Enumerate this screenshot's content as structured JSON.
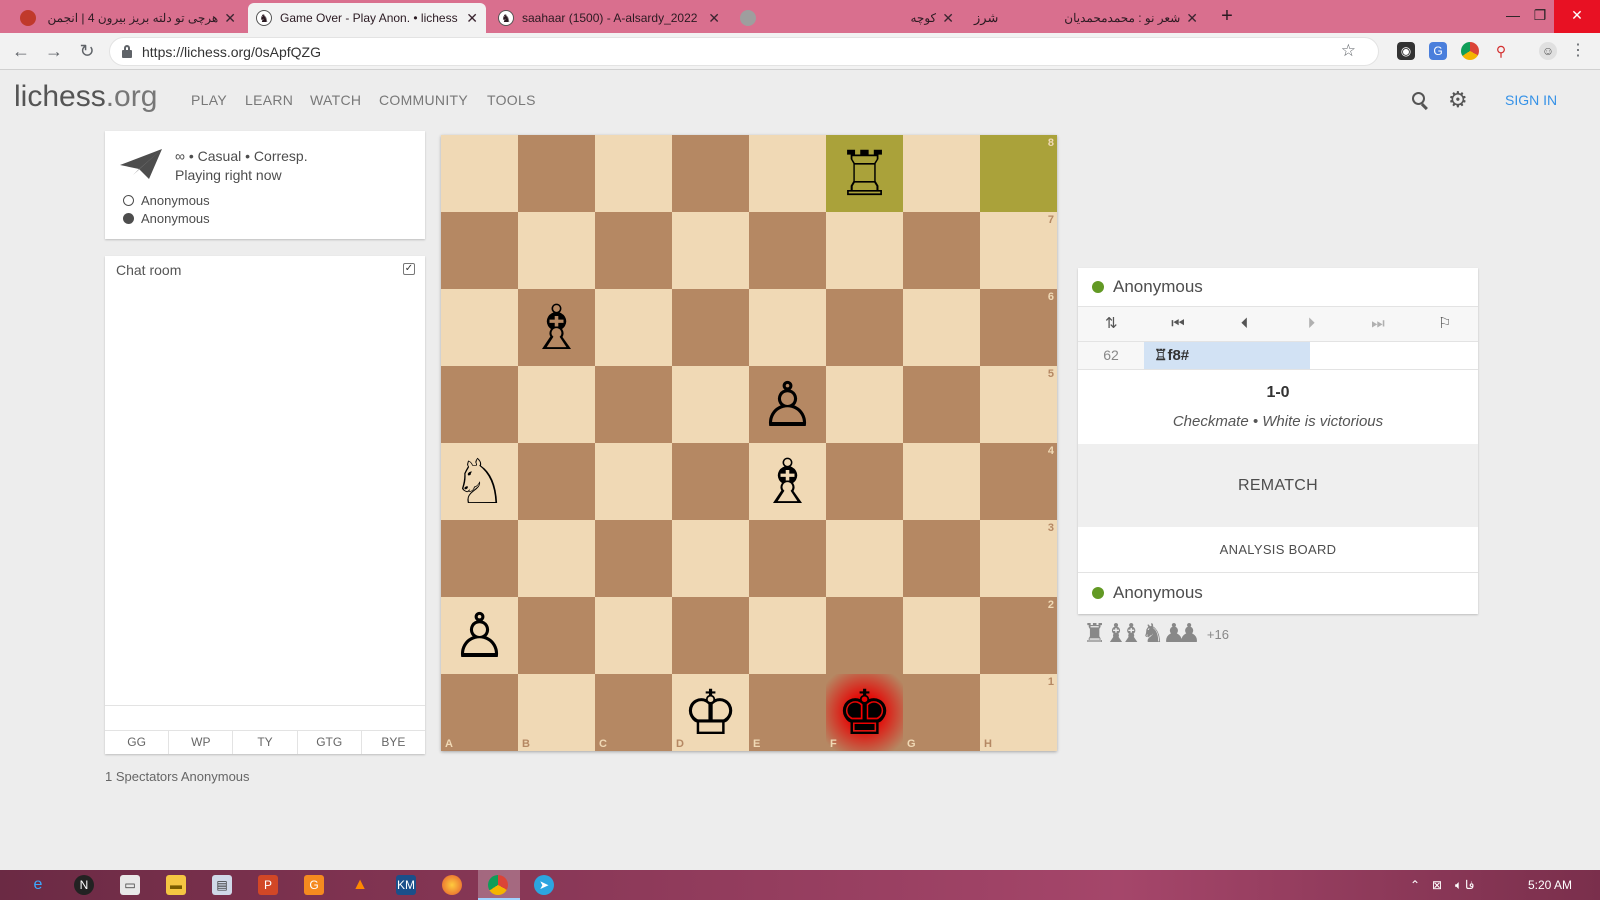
{
  "browser": {
    "tabs": [
      {
        "title": "هرچی تو دلته بریز بیرون 4 | انجمن",
        "rtl": true,
        "favicon_color": "#c0392b"
      },
      {
        "title": "Game Over - Play Anon. • lichess",
        "rtl": false,
        "favicon_color": "#ffffff"
      },
      {
        "title": "saahaar (1500) - A-alsardy_2022",
        "rtl": false,
        "favicon_color": "#ffffff"
      },
      {
        "title": "کوچه",
        "rtl": true,
        "favicon_color": "#9e9e9e"
      },
      {
        "title": "شعر نو : محمدمحمدیان",
        "rtl": true,
        "favicon_color": "#d96f8e"
      }
    ],
    "url": "https://lichess.org/0sApfQZG",
    "window_controls": {
      "minimize": "—",
      "restore": "❐",
      "close": "✕"
    }
  },
  "site": {
    "logo_main": "lichess",
    "logo_tld": ".org",
    "nav": [
      "PLAY",
      "LEARN",
      "WATCH",
      "COMMUNITY",
      "TOOLS"
    ],
    "sign_in": "SIGN IN"
  },
  "game_info": {
    "setup": "∞ • Casual • Corresp.",
    "status": "Playing right now",
    "players": [
      {
        "name": "Anonymous",
        "color": "white"
      },
      {
        "name": "Anonymous",
        "color": "black"
      }
    ]
  },
  "chat": {
    "title": "Chat room",
    "enabled": true,
    "presets": [
      "GG",
      "WP",
      "TY",
      "GTG",
      "BYE"
    ]
  },
  "spectators": "1 Spectators Anonymous",
  "board": {
    "files": [
      "A",
      "B",
      "C",
      "D",
      "E",
      "F",
      "G",
      "H"
    ],
    "ranks": [
      "8",
      "7",
      "6",
      "5",
      "4",
      "3",
      "2",
      "1"
    ],
    "last_move_squares": [
      "f8",
      "h8"
    ],
    "check_square": "f1",
    "pieces": [
      {
        "square": "f8",
        "glyph": "♖",
        "name": "white-rook"
      },
      {
        "square": "b6",
        "glyph": "♗",
        "name": "white-bishop"
      },
      {
        "square": "e5",
        "glyph": "♙",
        "name": "white-pawn"
      },
      {
        "square": "a4",
        "glyph": "♘",
        "name": "white-knight"
      },
      {
        "square": "e4",
        "glyph": "♗",
        "name": "white-bishop"
      },
      {
        "square": "a2",
        "glyph": "♙",
        "name": "white-pawn"
      },
      {
        "square": "d1",
        "glyph": "♔",
        "name": "white-king"
      },
      {
        "square": "f1",
        "glyph": "♚",
        "name": "black-king"
      }
    ]
  },
  "right_panel": {
    "top_player": "Anonymous",
    "bottom_player": "Anonymous",
    "controls": [
      {
        "glyph": "⇅",
        "name": "flip-board-icon",
        "disabled": false
      },
      {
        "glyph": "⏮",
        "name": "first-move-icon",
        "disabled": false
      },
      {
        "glyph": "⏴",
        "name": "prev-move-icon",
        "disabled": false
      },
      {
        "glyph": "⏵",
        "name": "next-move-icon",
        "disabled": true
      },
      {
        "glyph": "⏭",
        "name": "last-move-icon",
        "disabled": true
      },
      {
        "glyph": "⚐",
        "name": "resign-flag-icon",
        "disabled": false
      }
    ],
    "move_number": "62",
    "move_san": "♖f8#",
    "result_score": "1-0",
    "result_text": "Checkmate • White is victorious",
    "rematch": "REMATCH",
    "analysis": "ANALYSIS BOARD"
  },
  "material": {
    "groups": [
      "♜",
      "♝♝",
      "♞",
      "♟♟"
    ],
    "diff": "+16"
  },
  "taskbar": {
    "lang": "فا",
    "clock": "5:20 AM"
  },
  "colors": {
    "light_square": "#f0d9b5",
    "dark_square": "#b58863",
    "last_move": "#aaa23a",
    "accent": "#3692e7",
    "online": "#629924",
    "tab_strip": "#d96f8e"
  }
}
